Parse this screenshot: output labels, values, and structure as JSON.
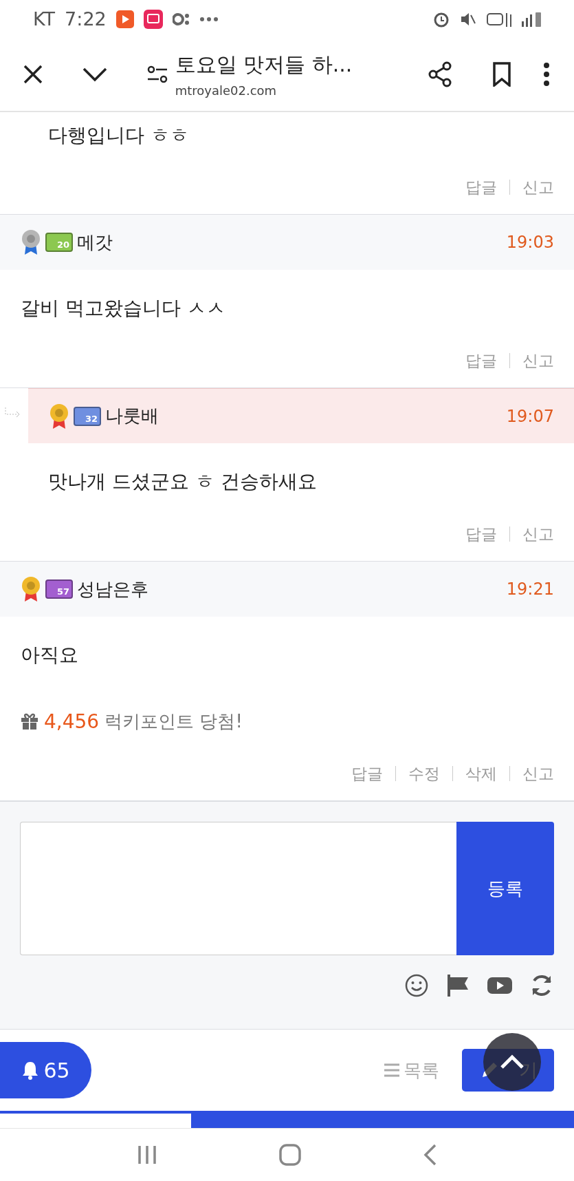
{
  "status_bar": {
    "carrier": "KT",
    "time": "7:22"
  },
  "browser": {
    "title": "토요일 맛저들 하...",
    "url": "mtroyale02.com"
  },
  "comments": [
    {
      "kind": "tail",
      "body": "다행입니다 ㅎㅎ",
      "actions": [
        "답글",
        "신고"
      ]
    },
    {
      "kind": "full",
      "reply": false,
      "medal": {
        "color": "#b5b5b5"
      },
      "level": "20",
      "color": "#8cc850",
      "author": "메갓",
      "time": "19:03",
      "body": "갈비 먹고왔습니다 ㅅㅅ",
      "actions": [
        "답글",
        "신고"
      ]
    },
    {
      "kind": "full",
      "reply": true,
      "medal": {
        "color": "#f0b82a"
      },
      "level": "32",
      "color": "#6f8fe0",
      "author": "나룻배",
      "time": "19:07",
      "body": "맛나개 드셨군요 ㅎ 건승하새요",
      "actions": [
        "답글",
        "신고"
      ]
    },
    {
      "kind": "full",
      "reply": false,
      "medal": {
        "color": "#f0b82a"
      },
      "level": "57",
      "color": "#a35fd0",
      "author": "성남은후",
      "time": "19:21",
      "body": "아직요",
      "prize": {
        "amount": "4,456",
        "text": "럭키포인트 당첨!"
      },
      "actions": [
        "답글",
        "수정",
        "삭제",
        "신고"
      ]
    }
  ],
  "comment_form": {
    "submit": "등록"
  },
  "bottom_bar": {
    "notifications": "65",
    "list": "목록",
    "write": "기"
  }
}
